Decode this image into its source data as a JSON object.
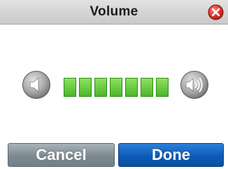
{
  "dialog": {
    "title": "Volume"
  },
  "volume": {
    "level": 7,
    "max": 7
  },
  "buttons": {
    "cancel_label": "Cancel",
    "done_label": "Done"
  },
  "icons": {
    "close": "close-icon",
    "volume_down": "speaker-low-icon",
    "volume_up": "speaker-high-icon"
  },
  "colors": {
    "level_on": "#5cc636",
    "cancel_button": "#7d8990",
    "done_button": "#0d5cb8",
    "close_button": "#d7261c"
  }
}
